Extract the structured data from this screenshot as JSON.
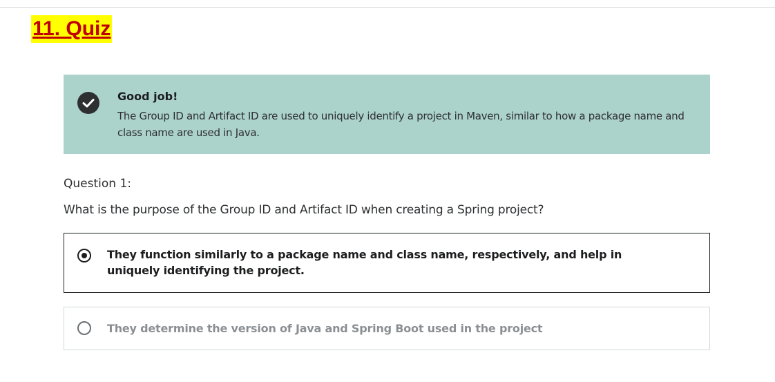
{
  "page": {
    "heading": "11. Quiz"
  },
  "feedback": {
    "icon": "check-circle-icon",
    "title": "Good job!",
    "body": "The Group ID and Artifact ID are used to uniquely identify a project in Maven, similar to how a package name and class name are used in Java.",
    "background_color": "#acd2cc"
  },
  "question": {
    "number_label": "Question 1:",
    "text": "What is the purpose of the Group ID and Artifact ID when creating a Spring project?",
    "options": [
      {
        "label": "They function similarly to a package name and class name, respectively, and help in uniquely identifying the project.",
        "selected": true
      },
      {
        "label": "They determine the version of Java and Spring Boot used in the project",
        "selected": false
      }
    ]
  }
}
